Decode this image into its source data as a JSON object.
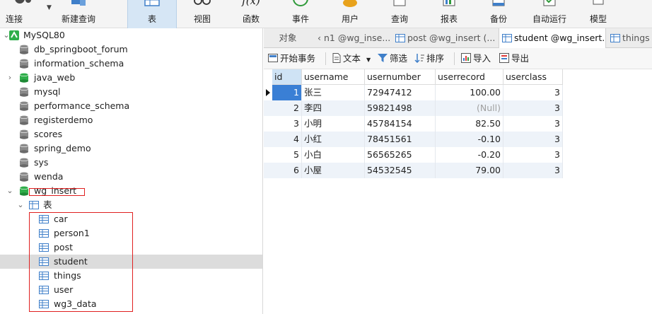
{
  "toolbar": {
    "items": [
      {
        "label": "连接",
        "icon": "connection-icon"
      },
      {
        "label": "新建查询",
        "icon": "new-query-icon"
      },
      {
        "label": "表",
        "icon": "table-icon",
        "active": true
      },
      {
        "label": "视图",
        "icon": "view-icon"
      },
      {
        "label": "函数",
        "icon": "function-icon",
        "glyph": "f(x)"
      },
      {
        "label": "事件",
        "icon": "event-clock-icon"
      },
      {
        "label": "用户",
        "icon": "user-icon"
      },
      {
        "label": "查询",
        "icon": "query-icon"
      },
      {
        "label": "报表",
        "icon": "report-icon"
      },
      {
        "label": "备份",
        "icon": "backup-icon"
      },
      {
        "label": "自动运行",
        "icon": "auto-run-icon"
      },
      {
        "label": "模型",
        "icon": "model-icon"
      }
    ]
  },
  "tree": {
    "connection": "MySQL80",
    "databases": [
      "db_springboot_forum",
      "information_schema",
      "java_web",
      "mysql",
      "performance_schema",
      "registerdemo",
      "scores",
      "spring_demo",
      "sys",
      "wenda",
      "wg_insert"
    ],
    "tables_folder": "表",
    "tables": [
      "car",
      "person1",
      "post",
      "student",
      "things",
      "user",
      "wg3_data"
    ],
    "selected_table": "student"
  },
  "tabs": [
    {
      "label": "对象"
    },
    {
      "label": "n1 @wg_inse..."
    },
    {
      "label": "post @wg_insert (..."
    },
    {
      "label": "student @wg_insert..."
    },
    {
      "label": "things @"
    }
  ],
  "subbar": {
    "begin_tx": "开始事务",
    "text": "文本",
    "filter": "筛选",
    "sort": "排序",
    "import": "导入",
    "export": "导出"
  },
  "grid": {
    "columns": [
      "id",
      "username",
      "usernumber",
      "userrecord",
      "userclass"
    ],
    "rows": [
      {
        "id": "1",
        "username": "张三",
        "usernumber": "72947412",
        "userrecord": "100.00",
        "userclass": "3"
      },
      {
        "id": "2",
        "username": "李四",
        "usernumber": "59821498",
        "userrecord": "(Null)",
        "userclass": "3"
      },
      {
        "id": "3",
        "username": "小明",
        "usernumber": "45784154",
        "userrecord": "82.50",
        "userclass": "3"
      },
      {
        "id": "4",
        "username": "小红",
        "usernumber": "78451561",
        "userrecord": "-0.10",
        "userclass": "3"
      },
      {
        "id": "5",
        "username": "小白",
        "usernumber": "56565265",
        "userrecord": "-0.20",
        "userclass": "3"
      },
      {
        "id": "6",
        "username": "小屋",
        "usernumber": "54532545",
        "userrecord": "79.00",
        "userclass": "3"
      }
    ]
  },
  "colors": {
    "accent": "#3a7fd5",
    "active_tab_bg": "#d6e6f5",
    "db_green": "#2fae4a",
    "highlight_box": "#e02020"
  }
}
